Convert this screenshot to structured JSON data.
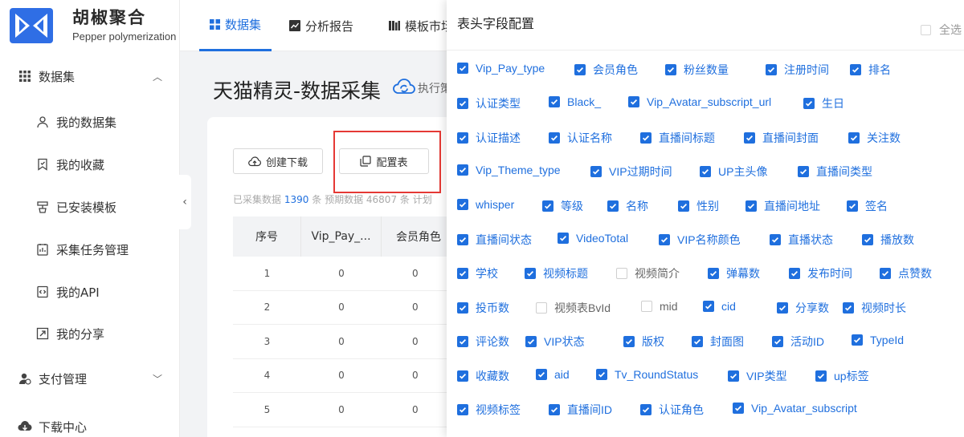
{
  "app": {
    "name": "胡椒聚合",
    "subtitle": "Pepper polymerization"
  },
  "sidebar": {
    "groups": [
      {
        "label": "数据集",
        "icon": "grid-icon",
        "expanded": true
      },
      {
        "label": "支付管理",
        "icon": "pay-icon",
        "expanded": false
      },
      {
        "label": "下载中心",
        "icon": "cloud-download-icon"
      }
    ],
    "items": [
      {
        "label": "我的数据集",
        "icon": "user-icon"
      },
      {
        "label": "我的收藏",
        "icon": "bookmark-icon"
      },
      {
        "label": "已安装模板",
        "icon": "template-icon"
      },
      {
        "label": "采集任务管理",
        "icon": "task-icon"
      },
      {
        "label": "我的API",
        "icon": "api-icon"
      },
      {
        "label": "我的分享",
        "icon": "share-icon"
      }
    ]
  },
  "tabs": [
    {
      "label": "数据集",
      "active": true
    },
    {
      "label": "分析报告",
      "active": false
    },
    {
      "label": "模板市场",
      "active": false
    }
  ],
  "page": {
    "title": "天猫精灵-数据采集",
    "exec_label": "执行策略"
  },
  "toolbar": {
    "create_download": "创建下载",
    "config_table": "配置表"
  },
  "stats": {
    "collected_label": "已采集数据",
    "collected_count": "1390",
    "unit1": "条",
    "expected_label": "预期数据",
    "expected_count": "46807",
    "unit2": "条",
    "tail": "计划"
  },
  "table": {
    "headers": [
      "序号",
      "Vip_Pay_...",
      "会员角色"
    ],
    "rows": [
      [
        "1",
        "0",
        "0"
      ],
      [
        "2",
        "0",
        "0"
      ],
      [
        "3",
        "0",
        "0"
      ],
      [
        "4",
        "0",
        "0"
      ],
      [
        "5",
        "0",
        "0"
      ]
    ]
  },
  "config_panel": {
    "title": "表头字段配置",
    "select_all": "全选",
    "select_all_checked": false,
    "rows": [
      [
        {
          "label": "Vip_Pay_type",
          "checked": true
        },
        {
          "label": "会员角色",
          "checked": true
        },
        {
          "label": "粉丝数量",
          "checked": true
        },
        {
          "label": "注册时间",
          "checked": true
        },
        {
          "label": "排名",
          "checked": true
        }
      ],
      [
        {
          "label": "认证类型",
          "checked": true
        },
        {
          "label": "Black_",
          "checked": true
        },
        {
          "label": "Vip_Avatar_subscript_url",
          "checked": true
        },
        {
          "label": "生日",
          "checked": true
        }
      ],
      [
        {
          "label": "认证描述",
          "checked": true
        },
        {
          "label": "认证名称",
          "checked": true
        },
        {
          "label": "直播间标题",
          "checked": true
        },
        {
          "label": "直播间封面",
          "checked": true
        },
        {
          "label": "关注数",
          "checked": true
        }
      ],
      [
        {
          "label": "Vip_Theme_type",
          "checked": true
        },
        {
          "label": "VIP过期时间",
          "checked": true
        },
        {
          "label": "UP主头像",
          "checked": true
        },
        {
          "label": "直播间类型",
          "checked": true
        }
      ],
      [
        {
          "label": "whisper",
          "checked": true
        },
        {
          "label": "等级",
          "checked": true
        },
        {
          "label": "名称",
          "checked": true
        },
        {
          "label": "性别",
          "checked": true
        },
        {
          "label": "直播间地址",
          "checked": true
        },
        {
          "label": "签名",
          "checked": true
        }
      ],
      [
        {
          "label": "直播间状态",
          "checked": true
        },
        {
          "label": "VideoTotal",
          "checked": true
        },
        {
          "label": "VIP名称颜色",
          "checked": true
        },
        {
          "label": "直播状态",
          "checked": true
        },
        {
          "label": "播放数",
          "checked": true
        }
      ],
      [
        {
          "label": "学校",
          "checked": true
        },
        {
          "label": "视频标题",
          "checked": true
        },
        {
          "label": "视频简介",
          "checked": false
        },
        {
          "label": "弹幕数",
          "checked": true
        },
        {
          "label": "发布时间",
          "checked": true
        },
        {
          "label": "点赞数",
          "checked": true
        }
      ],
      [
        {
          "label": "投币数",
          "checked": true
        },
        {
          "label": "视频表BvId",
          "checked": false
        },
        {
          "label": "mid",
          "checked": false
        },
        {
          "label": "cid",
          "checked": true
        },
        {
          "label": "分享数",
          "checked": true
        },
        {
          "label": "视频时长",
          "checked": true
        }
      ],
      [
        {
          "label": "评论数",
          "checked": true
        },
        {
          "label": "VIP状态",
          "checked": true
        },
        {
          "label": "版权",
          "checked": true
        },
        {
          "label": "封面图",
          "checked": true
        },
        {
          "label": "活动ID",
          "checked": true
        },
        {
          "label": "TypeId",
          "checked": true
        }
      ],
      [
        {
          "label": "收藏数",
          "checked": true
        },
        {
          "label": "aid",
          "checked": true
        },
        {
          "label": "Tv_RoundStatus",
          "checked": true
        },
        {
          "label": "VIP类型",
          "checked": true
        },
        {
          "label": "up标签",
          "checked": true
        }
      ],
      [
        {
          "label": "视频标签",
          "checked": true
        },
        {
          "label": "直播间ID",
          "checked": true
        },
        {
          "label": "认证角色",
          "checked": true
        },
        {
          "label": "Vip_Avatar_subscript",
          "checked": true
        }
      ]
    ]
  },
  "colors": {
    "accent": "#1f6fde",
    "highlight": "#e53935"
  }
}
